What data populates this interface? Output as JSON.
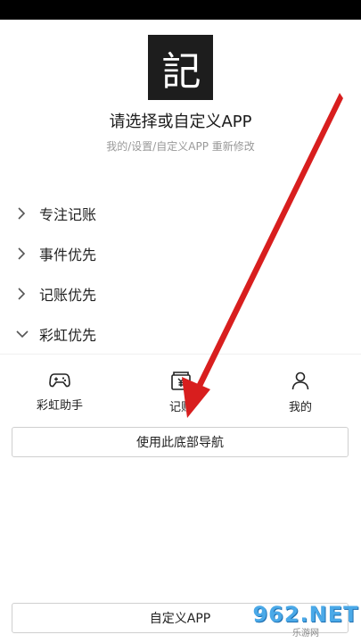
{
  "logo": {
    "glyph": "記"
  },
  "header": {
    "title": "请选择或自定义APP",
    "subtitle": "我的/设置/自定义APP 重新修改"
  },
  "options": [
    {
      "label": "专注记账",
      "state": "collapsed"
    },
    {
      "label": "事件优先",
      "state": "collapsed"
    },
    {
      "label": "记账优先",
      "state": "collapsed"
    },
    {
      "label": "彩虹优先",
      "state": "expanded"
    }
  ],
  "nav_preview": {
    "items": [
      {
        "label": "彩虹助手",
        "icon": "gamepad-icon"
      },
      {
        "label": "记账",
        "icon": "wallet-icon"
      },
      {
        "label": "我的",
        "icon": "user-icon"
      }
    ]
  },
  "buttons": {
    "use_nav": "使用此底部导航",
    "custom_app": "自定义APP"
  },
  "watermark": {
    "main": "962.NET",
    "sub": "乐游网"
  },
  "colors": {
    "arrow": "#d81e1e",
    "logo_bg": "#1d1d1d",
    "watermark": "#4aa9e8"
  }
}
